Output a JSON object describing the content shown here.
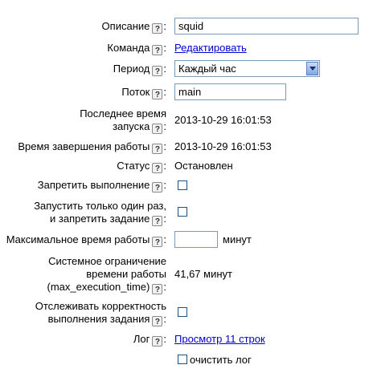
{
  "help_glyph": "?",
  "colon": ":",
  "fields": {
    "description": {
      "label": "Описание",
      "value": "squid"
    },
    "command": {
      "label": "Команда",
      "link": "Редактировать"
    },
    "period": {
      "label": "Период",
      "selected": "Каждый час"
    },
    "thread": {
      "label": "Поток",
      "value": "main"
    },
    "last_run": {
      "label_line1": "Последнее время",
      "label_line2": "запуска",
      "value": "2013-10-29 16:01:53"
    },
    "end_time": {
      "label": "Время завершения работы",
      "value": "2013-10-29 16:01:53"
    },
    "status": {
      "label": "Статус",
      "value": "Остановлен"
    },
    "forbid": {
      "label": "Запретить выполнение",
      "checked": false
    },
    "run_once": {
      "label_line1": "Запустить только один раз,",
      "label_line2": "и запретить задание",
      "checked": false
    },
    "max_time": {
      "label": "Максимальное время работы",
      "value": "",
      "unit": "минут"
    },
    "sys_limit": {
      "label_line1": "Системное ограничение",
      "label_line2": "времени работы",
      "label_line3": "(max_execution_time)",
      "value": "41,67 минут"
    },
    "track": {
      "label_line1": "Отслеживать корректность",
      "label_line2": "выполнения задания",
      "checked": false
    },
    "log": {
      "label": "Лог",
      "link": "Просмотр 11 строк",
      "clear_label": "очистить лог",
      "clear_checked": false
    }
  }
}
